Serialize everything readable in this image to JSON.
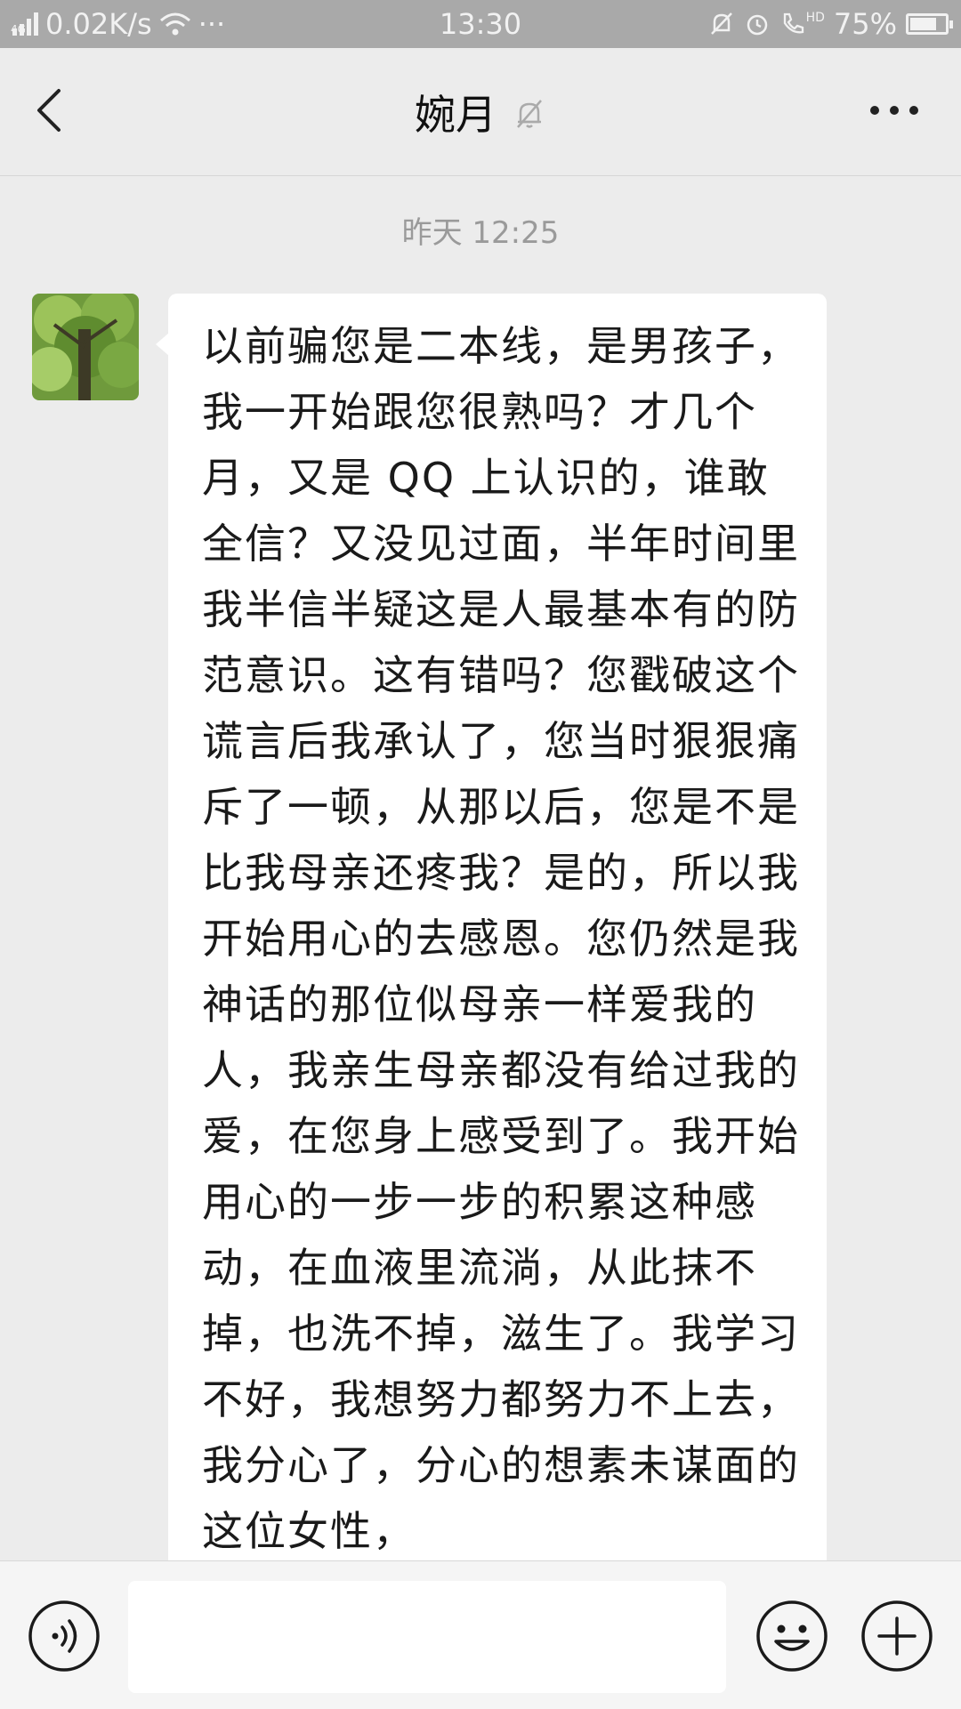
{
  "status_bar": {
    "network_type": "4G",
    "speed": "0.02K/s",
    "more": "···",
    "time": "13:30",
    "hd": "HD",
    "battery": "75%",
    "battery_level": 0.75,
    "icons": [
      "signal-icon",
      "wifi-icon",
      "alarm-off-icon",
      "alarm-icon",
      "hd-call-icon",
      "battery-icon"
    ]
  },
  "header": {
    "title": "婉月",
    "icons": [
      "back-arrow-icon",
      "mute-bell-icon",
      "more-options-icon"
    ]
  },
  "chat": {
    "timestamp": "昨天 12:25",
    "messages": [
      {
        "sender": "婉月",
        "text": "以前骗您是二本线，是男孩子，我一开始跟您很熟吗？才几个月，又是 QQ 上认识的，谁敢全信？又没见过面，半年时间里我半信半疑这是人最基本有的防范意识。这有错吗？您戳破这个谎言后我承认了，您当时狠狠痛斥了一顿，从那以后，您是不是比我母亲还疼我？是的，所以我开始用心的去感恩。您仍然是我神话的那位似母亲一样爱我的人，我亲生母亲都没有给过我的爱，在您身上感受到了。我开始用心的一步一步的积累这种感动，在血液里流淌，从此抹不掉，也洗不掉，滋生了。我学习不好，我想努力都努力不上去，我分心了，分心的想素未谋面的这位女性，"
      }
    ]
  },
  "input_bar": {
    "value": "",
    "icons": [
      "voice-icon",
      "emoji-icon",
      "plus-icon"
    ]
  }
}
